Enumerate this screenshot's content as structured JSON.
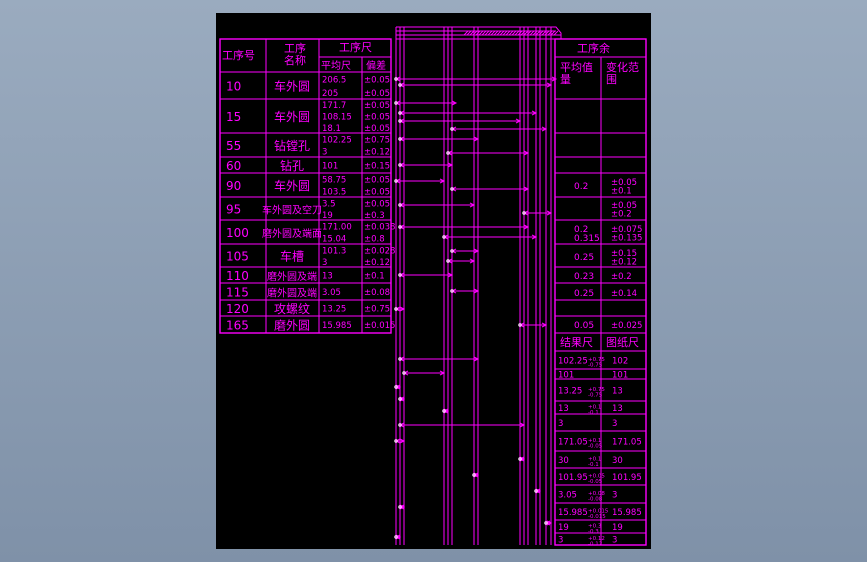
{
  "colors": {
    "drawing": "#ff00ff",
    "sheet": "#000000",
    "background": "#8a9bb0",
    "dims": "#ffffff"
  },
  "left_table": {
    "headers": {
      "step_no": "工序号",
      "step_name": "工序\n名称",
      "size_group": "工序尺",
      "avg": "平均尺",
      "dev": "偏差"
    },
    "rows": [
      {
        "no": "10",
        "name": "车外圆",
        "sizes": [
          "206.5",
          "205"
        ],
        "devs": [
          "±0.05",
          "±0.05"
        ]
      },
      {
        "no": "15",
        "name": "车外圆",
        "sizes": [
          "171.7",
          "108.15",
          "18.1"
        ],
        "devs": [
          "±0.05",
          "±0.05",
          "±0.05"
        ]
      },
      {
        "no": "55",
        "name": "钻镗孔",
        "sizes": [
          "102.25",
          "3"
        ],
        "devs": [
          "±0.75",
          "±0.12"
        ]
      },
      {
        "no": "60",
        "name": "钻孔",
        "sizes": [
          "101"
        ],
        "devs": [
          "±0.15"
        ]
      },
      {
        "no": "90",
        "name": "车外圆",
        "sizes": [
          "58.75",
          "103.5"
        ],
        "devs": [
          "±0.05",
          "±0.05"
        ]
      },
      {
        "no": "95",
        "name": "车外圆及空刀",
        "sizes": [
          "3.5",
          "19"
        ],
        "devs": [
          "±0.05",
          "±0.3"
        ]
      },
      {
        "no": "100",
        "name": "磨外圆及端面",
        "sizes": [
          "171.00",
          "15.04"
        ],
        "devs": [
          "±0.038",
          "±0.8"
        ]
      },
      {
        "no": "105",
        "name": "车槽",
        "sizes": [
          "101.3",
          "3"
        ],
        "devs": [
          "±0.028",
          "±0.12"
        ]
      },
      {
        "no": "110",
        "name": "磨外圆及端",
        "sizes": [
          "13"
        ],
        "devs": [
          "±0.1"
        ]
      },
      {
        "no": "115",
        "name": "磨外圆及端",
        "sizes": [
          "3.05"
        ],
        "devs": [
          "±0.08"
        ]
      },
      {
        "no": "120",
        "name": "攻螺纹",
        "sizes": [
          "13.25"
        ],
        "devs": [
          "±0.75"
        ]
      },
      {
        "no": "165",
        "name": "磨外圆",
        "sizes": [
          "15.985"
        ],
        "devs": [
          "±0.015"
        ]
      }
    ]
  },
  "right_table": {
    "headers": {
      "group": "工序余",
      "avg": "平均值\n量",
      "var": "变化范\n围"
    },
    "rows": [
      {
        "avg": "",
        "var": ""
      },
      {
        "avg": "",
        "var": ""
      },
      {
        "avg": "",
        "var": ""
      },
      {
        "avg": "",
        "var": ""
      },
      {
        "avg": "0.2",
        "var": "±0.05\n±0.1"
      },
      {
        "avg": "",
        "var": "±0.05\n±0.2"
      },
      {
        "avg": "0.2\n0.315",
        "var": "±0.075\n±0.135"
      },
      {
        "avg": "0.25",
        "var": "±0.15\n±0.12"
      },
      {
        "avg": "0.23",
        "var": "±0.2"
      },
      {
        "avg": "0.25",
        "var": "±0.14"
      },
      {
        "avg": "",
        "var": ""
      },
      {
        "avg": "0.05",
        "var": "±0.025"
      }
    ]
  },
  "result_table": {
    "headers": {
      "result": "结果尺",
      "drawing": "图纸尺"
    },
    "rows": [
      {
        "result": "102.25",
        "result_tol": "+0.75\n-0.75",
        "drawing": "102"
      },
      {
        "result": "101",
        "result_tol": "",
        "drawing": "101"
      },
      {
        "result": "13.25",
        "result_tol": "+0.75\n-0.75",
        "drawing": "13"
      },
      {
        "result": "13",
        "result_tol": "+0.1\n-0.1",
        "drawing": "13"
      },
      {
        "result": "3",
        "result_tol": "",
        "drawing": "3"
      },
      {
        "result": "171.05",
        "result_tol": "+0.1\n-0.05",
        "drawing": "171.05"
      },
      {
        "result": "30",
        "result_tol": "+0.1\n-0.1",
        "drawing": "30"
      },
      {
        "result": "101.95",
        "result_tol": "+0.05\n-0.05",
        "drawing": "101.95"
      },
      {
        "result": "3.05",
        "result_tol": "+0.08\n-0.08",
        "drawing": "3"
      },
      {
        "result": "15.985",
        "result_tol": "+0.015\n-0.015",
        "drawing": "15.985"
      },
      {
        "result": "19",
        "result_tol": "+0.3\n-0.3",
        "drawing": "19"
      },
      {
        "result": "3",
        "result_tol": "+0.12\n-0.12",
        "drawing": "3"
      }
    ]
  }
}
